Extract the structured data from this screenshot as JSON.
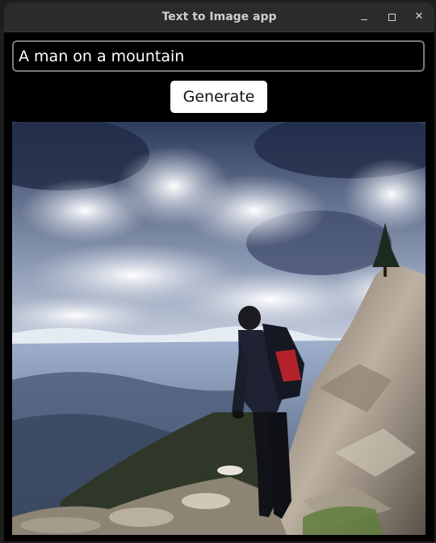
{
  "window": {
    "title": "Text to Image app"
  },
  "prompt": {
    "value": "A man on a mountain"
  },
  "generate_button": {
    "label": "Generate"
  },
  "generated_image": {
    "description_icon": "mountain-photo"
  },
  "colors": {
    "window_bg": "#000000",
    "titlebar_bg": "#2b2b2b",
    "button_bg": "#ffffff",
    "input_border": "#7a7a7a"
  }
}
